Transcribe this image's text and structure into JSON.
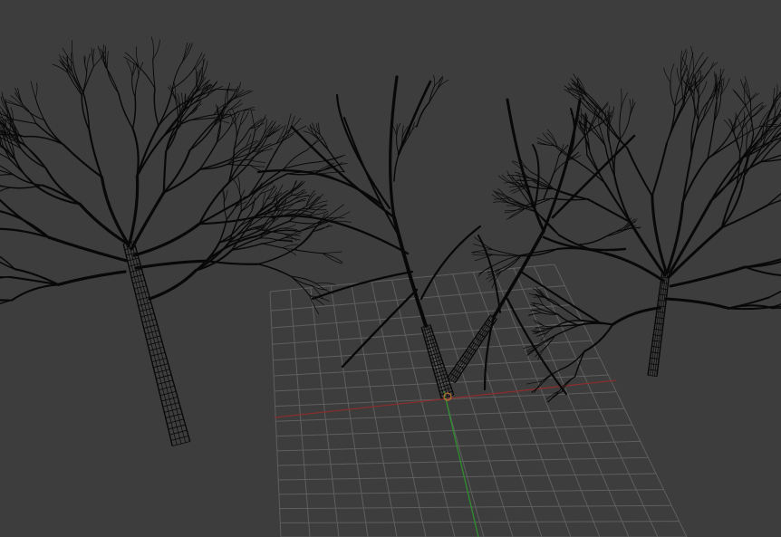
{
  "viewport": {
    "background": "#3d3d3d",
    "grid_color": "#5f5f5f",
    "x_axis_color": "#8a2d2d",
    "y_axis_color": "#2f8f2f",
    "mesh_color": "#080808"
  },
  "objects": [
    {
      "name": "tree-left",
      "kind": "wireframe-tree"
    },
    {
      "name": "tree-center",
      "kind": "wireframe-tree",
      "selected": true
    },
    {
      "name": "tree-right",
      "kind": "wireframe-tree"
    }
  ]
}
